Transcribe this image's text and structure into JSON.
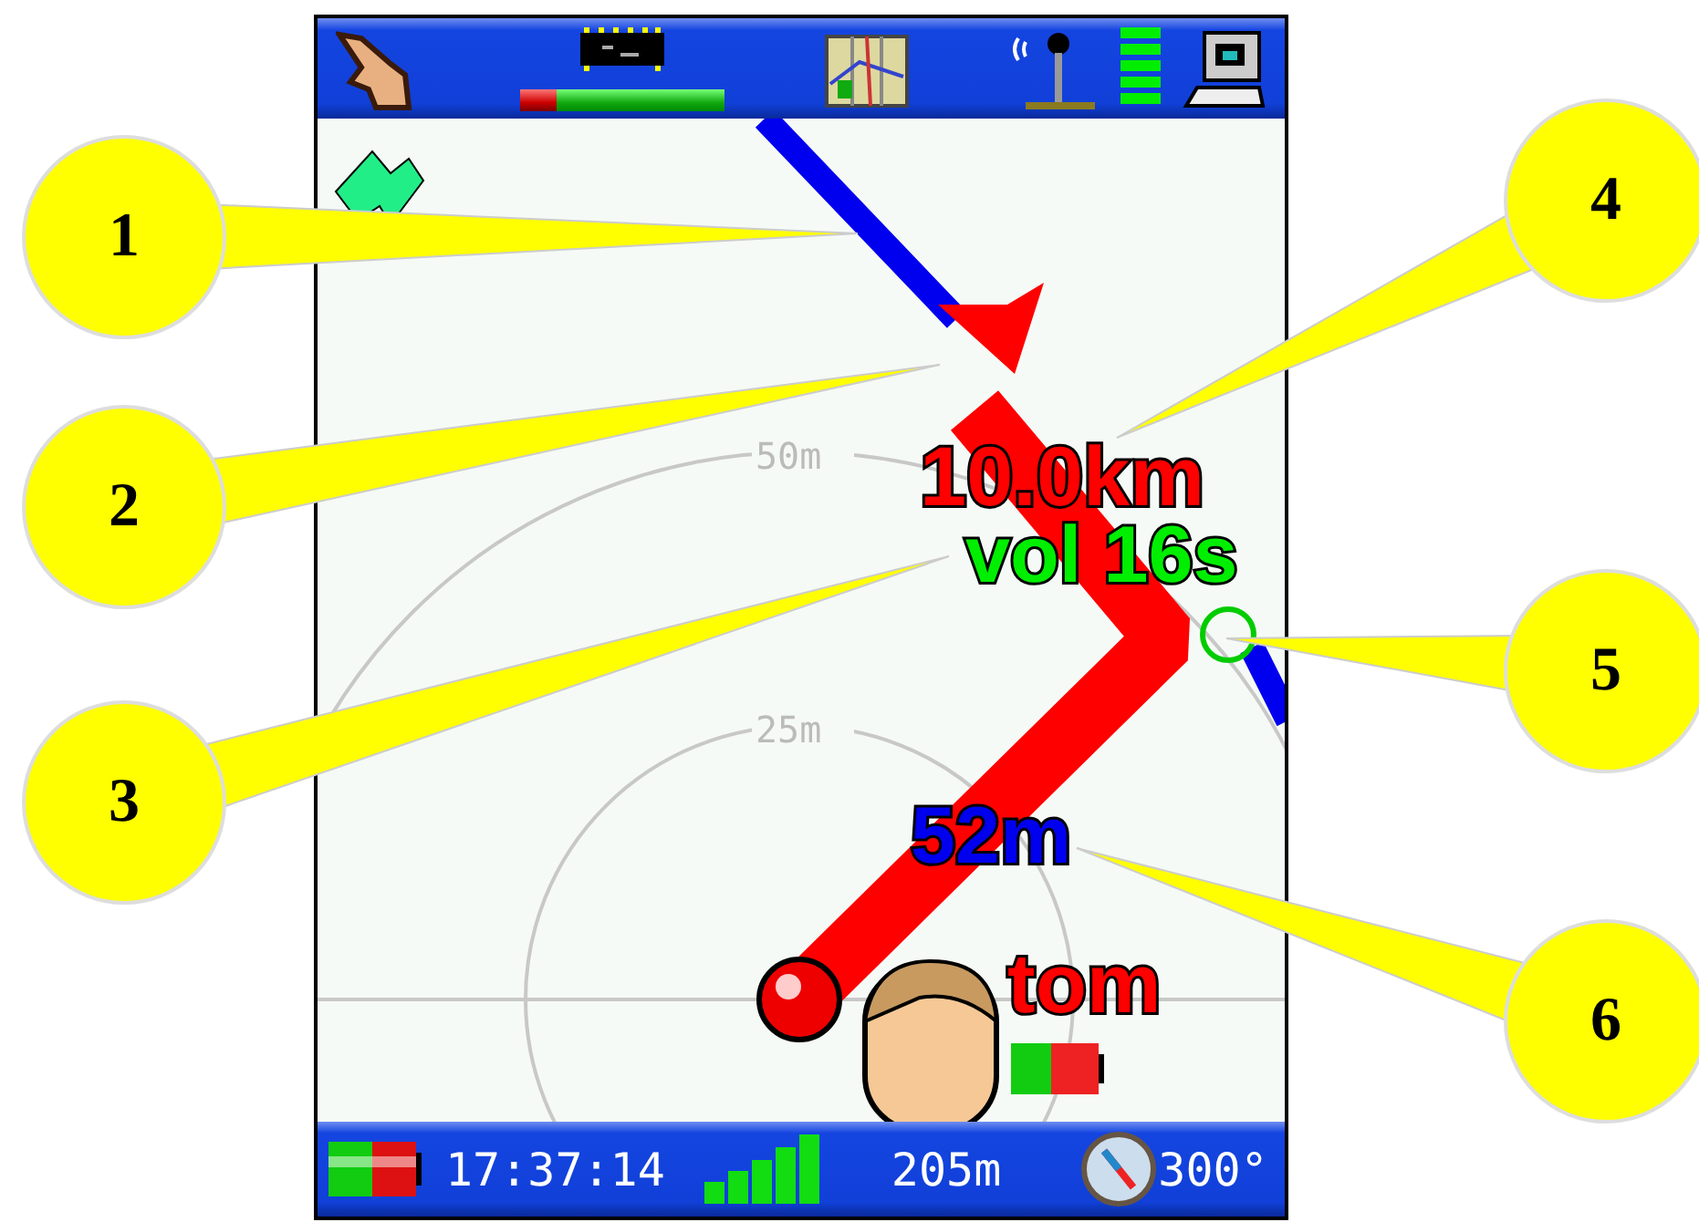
{
  "top_bar": {
    "storage_bar": {
      "level": 0.18
    }
  },
  "map": {
    "rings": [
      {
        "label": "50m"
      },
      {
        "label": "25m"
      }
    ],
    "distance": "10.0km",
    "volume": "vol 16s",
    "range": "52m",
    "buddy": {
      "name": "tom"
    }
  },
  "status_bar": {
    "time": "17:37:14",
    "altitude": "205m",
    "heading": "300°"
  },
  "callouts": [
    {
      "number": "1"
    },
    {
      "number": "2"
    },
    {
      "number": "3"
    },
    {
      "number": "4"
    },
    {
      "number": "5"
    },
    {
      "number": "6"
    }
  ]
}
